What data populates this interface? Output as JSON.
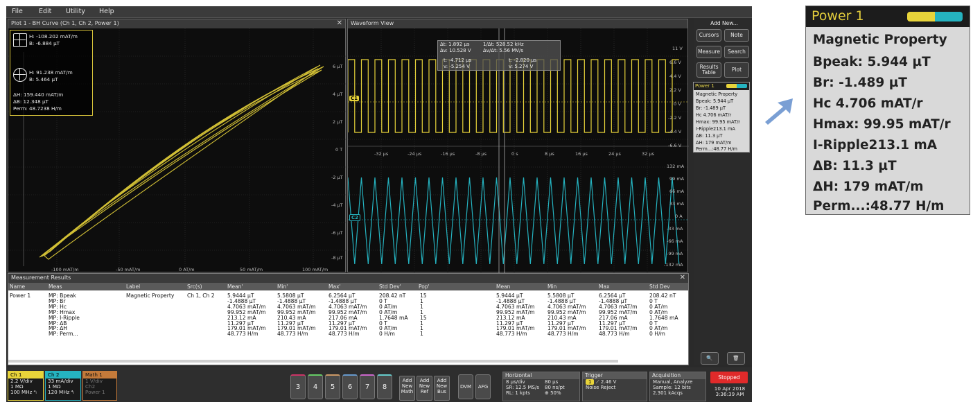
{
  "menu": [
    "File",
    "Edit",
    "Utility",
    "Help"
  ],
  "bh_plot": {
    "title": "Plot 1 - BH Curve (Ch 1, Ch 2, Power 1)",
    "cursor1": {
      "h": "H: -108.202 mAT/m",
      "b": "B: -6.884 µT"
    },
    "cursor2": {
      "h": "H: 91.238 mAT/m",
      "b": "B: 5.464 µT"
    },
    "delta_h": "ΔH: 159.440 mAT/m",
    "delta_b": "ΔB: 12.348 µT",
    "perm": "Perm: 48.7238 H/m",
    "y_ticks": [
      "6 µT",
      "4 µT",
      "2 µT",
      "0 T",
      "-2 µT",
      "-4 µT",
      "-6 µT",
      "-8 µT"
    ],
    "x_ticks": [
      "-100 mAT/m",
      "-50 mAT/m",
      "0 AT/m",
      "50 mAT/m",
      "100 mAT/m"
    ]
  },
  "waveform": {
    "title": "Waveform View",
    "readout": {
      "dt": "Δt: 1.892 µs",
      "inv_dt": "1/Δt: 528.52 kHz",
      "dv": "Δv: 10.528 V",
      "dvdt": "Δv/Δt: 5.56 MV/s",
      "c1_t": "t: -4.712 µs",
      "c1_v": "v: -5.254 V",
      "c2_t": "t: -2.820 µs",
      "c2_v": "v: 5.274 V"
    },
    "top_right_ticks": [
      "11 V",
      "6.6 V",
      "4.4 V",
      "2.2 V",
      "0 V",
      "-2.2 V",
      "-4.4 V",
      "-6.6 V"
    ],
    "time_ticks": [
      "-32 µs",
      "-24 µs",
      "-16 µs",
      "-8 µs",
      "0 s",
      "8 µs",
      "16 µs",
      "24 µs",
      "32 µs"
    ],
    "bottom_right_ticks": [
      "132 mA",
      "99 mA",
      "66 mA",
      "33 mA",
      "0 A",
      "-33 mA",
      "-66 mA",
      "-99 mA",
      "-132 mA"
    ],
    "ch1_label": "C1",
    "ch2_label": "C2"
  },
  "right_panel": {
    "add_new": "Add New...",
    "buttons": [
      "Cursors",
      "Note",
      "Measure",
      "Search",
      "Results Table",
      "Plot"
    ]
  },
  "power_badge": {
    "title": "Power 1",
    "heading": "Magnetic Property",
    "rows": [
      "Bpeak: 5.944 µT",
      "Br:       -1.489 µT",
      "Hc         4.706 mAT/r",
      "Hmax:    99.95 mAT/r",
      "I-Ripple213.1 mA",
      "ΔB:         11.3 µT",
      "ΔH:       179 mAT/m",
      "Perm...:48.77 H/m"
    ]
  },
  "measurement": {
    "title": "Measurement Results",
    "headers": [
      "Name",
      "Meas",
      "Label",
      "Src(s)",
      "Mean'",
      "Min'",
      "Max'",
      "Std Dev'",
      "Pop'",
      "Mean",
      "Min",
      "Max",
      "Std Dev"
    ],
    "name": "Power 1",
    "meas": "MP: Bpeak\nMP: Br\nMP: Hc\nMP: Hmax\nMP: I-Ripple\nMP: ΔB\nMP: ΔH\nMP: Perm...",
    "label": "Magnetic Property",
    "srcs": "Ch 1, Ch 2",
    "mean_p": "5.9444 µT\n-1.4888 µT\n4.7063 mAT/m\n99.952 mAT/m\n213.12 mA\n11.297 µT\n179.01 mAT/m\n48.773 H/m",
    "min_p": "5.5808 µT\n-1.4888 µT\n4.7063 mAT/m\n99.952 mAT/m\n210.43 mA\n11.297 µT\n179.01 mAT/m\n48.773 H/m",
    "max_p": "6.2564 µT\n-1.4888 µT\n4.7063 mAT/m\n99.952 mAT/m\n217.06 mA\n11.297 µT\n179.01 mAT/m\n48.773 H/m",
    "std_p": "208.42 nT\n0 T\n0 AT/m\n0 AT/m\n1.7648 mA\n0 T\n0 AT/m\n0 H/m",
    "pop_p": "15\n1\n1\n1\n15\n1\n1\n1",
    "mean": "5.9444 µT\n-1.4888 µT\n4.7063 mAT/m\n99.952 mAT/m\n213.12 mA\n11.297 µT\n179.01 mAT/m\n48.773 H/m",
    "min": "5.5808 µT\n-1.4888 µT\n4.7063 mAT/m\n99.952 mAT/m\n210.43 mA\n11.297 µT\n179.01 mAT/m\n48.773 H/m",
    "max": "6.2564 µT\n-1.4888 µT\n4.7063 mAT/m\n99.952 mAT/m\n217.06 mA\n11.297 µT\n179.01 mAT/m\n48.773 H/m",
    "std": "208.42 nT\n0 T\n0 AT/m\n0 AT/m\n1.7648 mA\n0 T\n0 AT/m\n0 H/m"
  },
  "channels": {
    "ch1": {
      "name": "Ch 1",
      "l1": "2.2 V/div",
      "l2": "1 MΩ",
      "l3": "100 MHz ⁴ₗ"
    },
    "ch2": {
      "name": "Ch 2",
      "l1": "33 mA/div",
      "l2": "1 MΩ",
      "l3": "120 MHz ⁴ₗ"
    },
    "math1": {
      "name": "Math 1",
      "l1": "1 V/div",
      "l2": "Ch2",
      "l3": "Power 1"
    }
  },
  "num_buttons": [
    "3",
    "4",
    "5",
    "6",
    "7",
    "8"
  ],
  "add_buttons": [
    "Add\nNew\nMath",
    "Add\nNew\nRef",
    "Add\nNew\nBus"
  ],
  "extra_buttons": [
    "DVM",
    "AFG"
  ],
  "horizontal": {
    "title": "Horizontal",
    "l1a": "8 µs/div",
    "l1b": "80 µs",
    "l2a": "SR: 12.5 MS/s",
    "l2b": "80 ns/pt",
    "l3a": "RL: 1 kpts",
    "l3b": "⊕ 50%"
  },
  "trigger": {
    "title": "Trigger",
    "l1a": "1",
    "l1b": "⟋  2.46 V",
    "l2": "Noise Reject"
  },
  "acquisition": {
    "title": "Acquisition",
    "l1": "Manual,   Analyze",
    "l2": "Sample: 12 bits",
    "l3": "2.301 kAcqs"
  },
  "status": {
    "stopped": "Stopped",
    "date": "10 Apr 2018",
    "time": "3:36:39 AM"
  },
  "colors": {
    "ch1": "#e8d43a",
    "ch2": "#25b3c0",
    "math": "#c47a3a",
    "stopped": "#e02a2a"
  }
}
